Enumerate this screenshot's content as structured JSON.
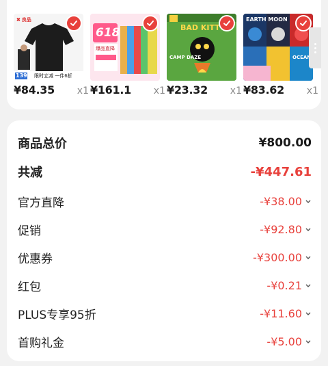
{
  "products": [
    {
      "price": "¥84.35",
      "qty": "x1",
      "thumb_text": "限时立减 一件6折",
      "thumb_badge": "139"
    },
    {
      "price": "¥161.1",
      "qty": "x1",
      "thumb_text": "618",
      "thumb_sub": "爆品直降"
    },
    {
      "price": "¥23.32",
      "qty": "x1",
      "thumb_text": "BAD KITTY",
      "thumb_sub": "CAMP DAZE"
    },
    {
      "price": "¥83.62",
      "qty": "x1",
      "thumb_text": "EARTH MOON",
      "thumb_sub": "OCEAN"
    }
  ],
  "summary": {
    "total_label": "商品总价",
    "total_amount": "¥800.00",
    "reduce_label": "共减",
    "reduce_amount": "-¥447.61",
    "items": [
      {
        "label": "官方直降",
        "amount": "-¥38.00"
      },
      {
        "label": "促销",
        "amount": "-¥92.80"
      },
      {
        "label": "优惠券",
        "amount": "-¥300.00"
      },
      {
        "label": "红包",
        "amount": "-¥0.21"
      },
      {
        "label": "PLUS专享95折",
        "amount": "-¥11.60"
      },
      {
        "label": "首购礼金",
        "amount": "-¥5.00"
      }
    ]
  },
  "colors": {
    "accent": "#e8413c",
    "background": "#f2f2f2"
  },
  "icons": {
    "selected": "check-icon",
    "expand": "chevron-down-icon",
    "more": "more-dots-icon"
  }
}
